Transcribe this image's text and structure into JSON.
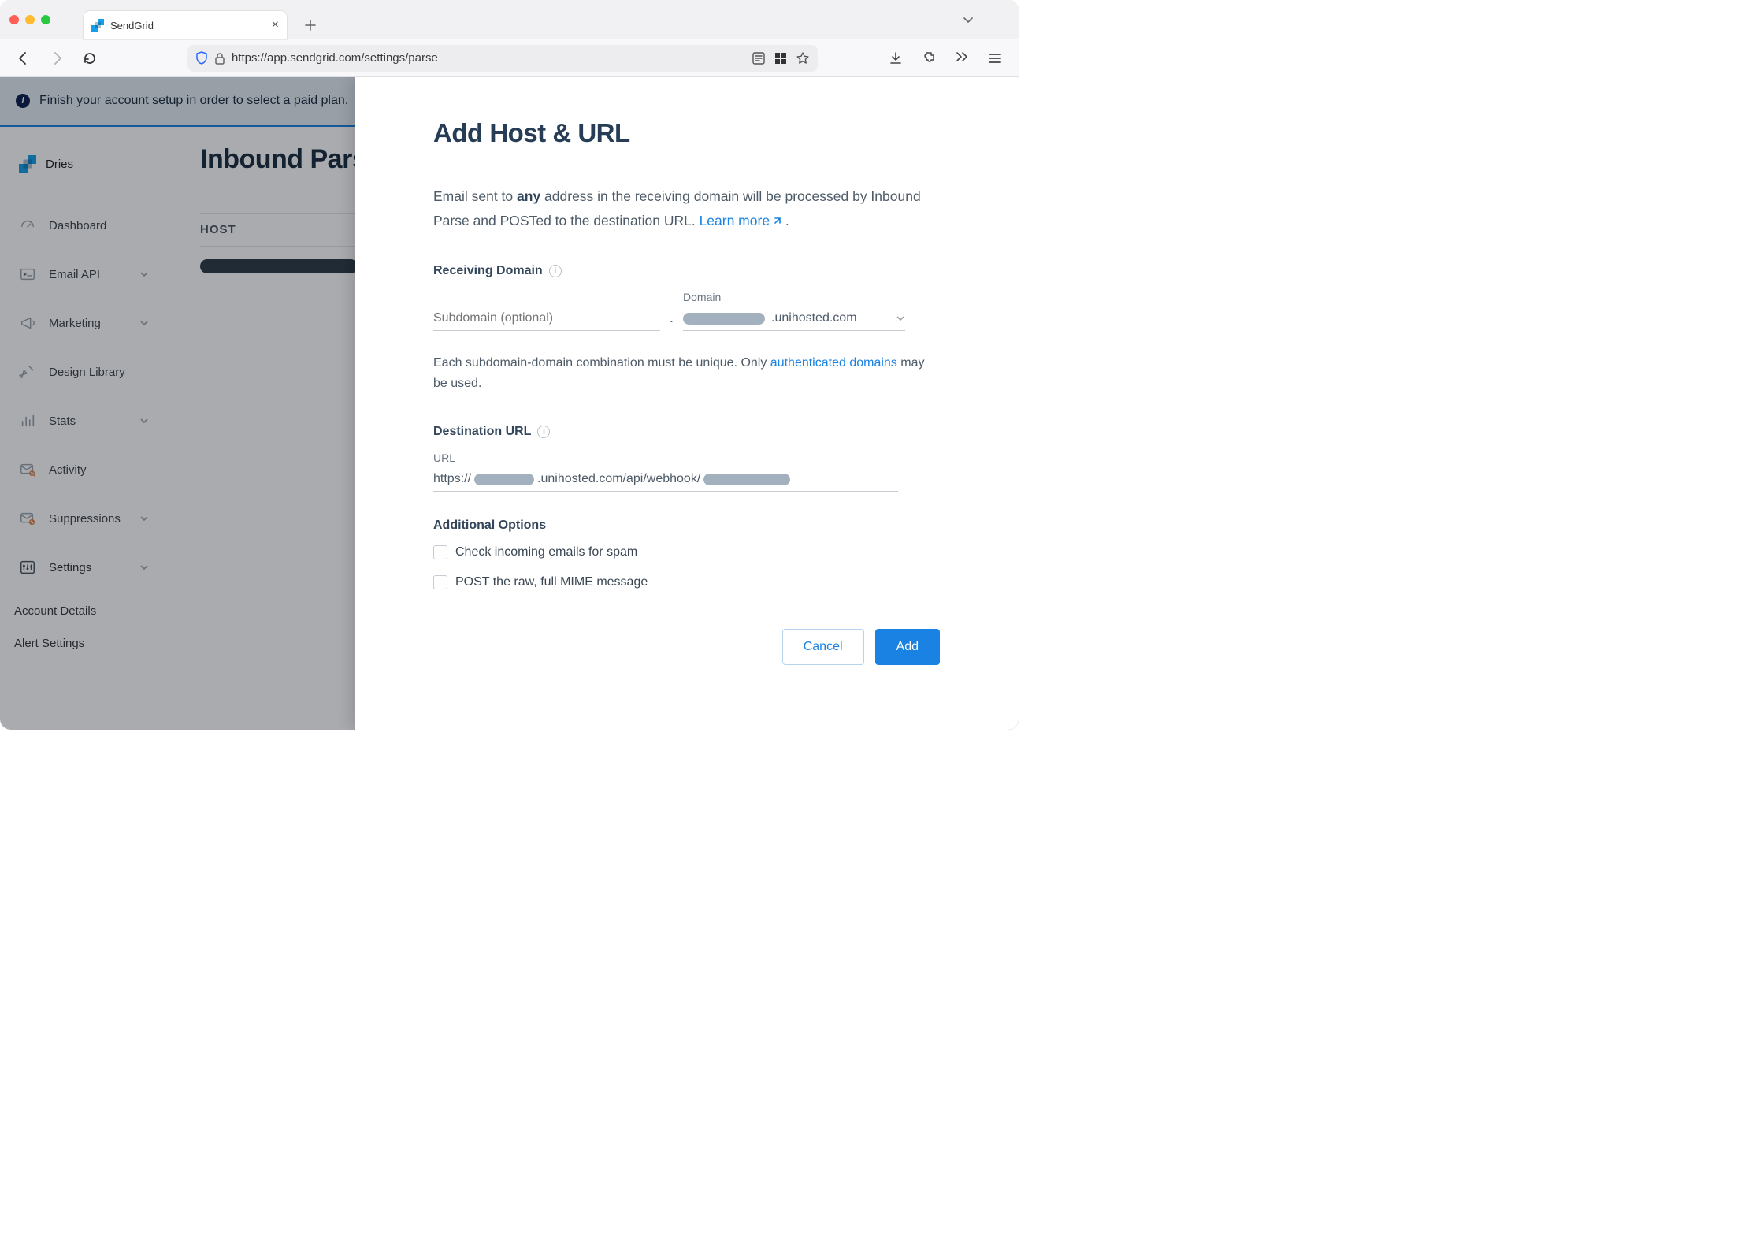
{
  "browser": {
    "tab_title": "SendGrid",
    "url": "https://app.sendgrid.com/settings/parse"
  },
  "banner": {
    "text": "Finish your account setup in order to select a paid plan."
  },
  "org": {
    "name": "Dries"
  },
  "sidebar": {
    "items": [
      {
        "label": "Dashboard"
      },
      {
        "label": "Email API"
      },
      {
        "label": "Marketing"
      },
      {
        "label": "Design Library"
      },
      {
        "label": "Stats"
      },
      {
        "label": "Activity"
      },
      {
        "label": "Suppressions"
      },
      {
        "label": "Settings"
      }
    ],
    "subnav": [
      "Account Details",
      "Alert Settings"
    ]
  },
  "main": {
    "title": "Inbound Parse",
    "table_header": "HOST"
  },
  "drawer": {
    "title": "Add Host & URL",
    "lead_pre": "Email sent to ",
    "lead_bold": "any",
    "lead_post": " address in the receiving domain will be processed by Inbound Parse and POSTed to the destination URL. ",
    "learn_more": "Learn more",
    "receiving_label": "Receiving Domain",
    "subdomain_placeholder": "Subdomain (optional)",
    "domain_label": "Domain",
    "domain_suffix": ".unihosted.com",
    "helper_pre": "Each subdomain-domain combination must be unique. Only ",
    "helper_link": "authenticated domains",
    "helper_post": " may be used.",
    "dest_label": "Destination URL",
    "url_label": "URL",
    "url_prefix": "https://",
    "url_mid": ".unihosted.com/api/webhook/",
    "options_label": "Additional Options",
    "opt_spam": "Check incoming emails for spam",
    "opt_raw": "POST the raw, full MIME message",
    "cancel": "Cancel",
    "add": "Add"
  }
}
